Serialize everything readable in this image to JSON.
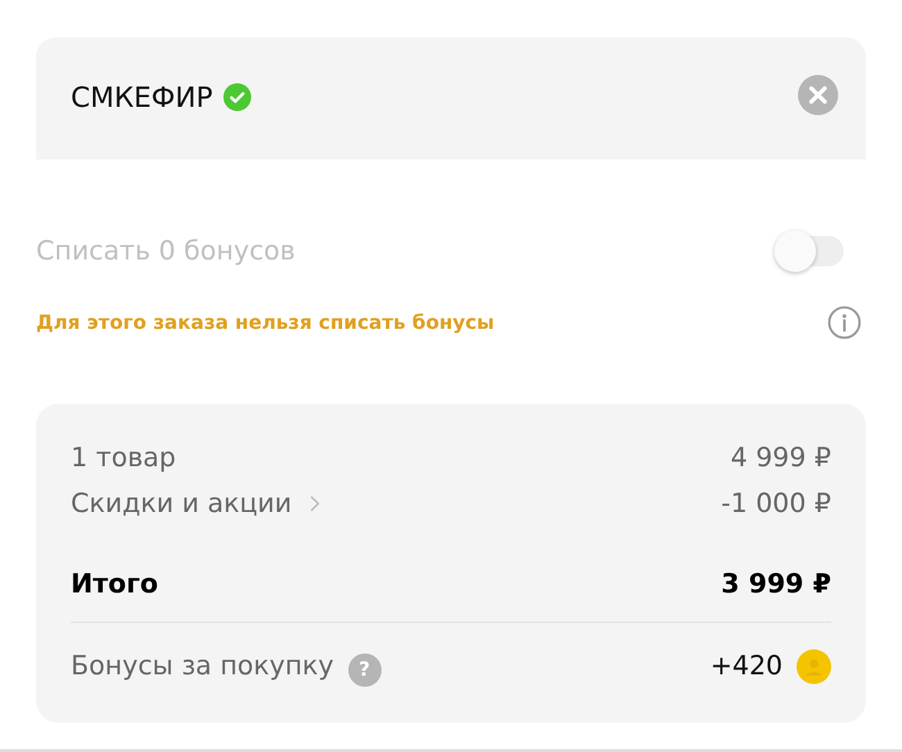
{
  "promo": {
    "code": "СМКЕФИР",
    "verified": true
  },
  "bonus_writeoff": {
    "label": "Списать 0 бонусов",
    "on": false,
    "disabled": true,
    "warning": "Для этого заказа нельзя списать бонусы"
  },
  "summary": {
    "rows": [
      {
        "kind": "plain",
        "label": "1 товар",
        "value": "4 999 ₽"
      },
      {
        "kind": "link",
        "label": "Скидки и акции",
        "value": "-1 000 ₽"
      },
      {
        "kind": "total",
        "label": "Итого",
        "value": "3 999 ₽"
      },
      {
        "kind": "bonus",
        "label": "Бонусы за покупку",
        "help": "?",
        "value": "+420"
      }
    ]
  }
}
